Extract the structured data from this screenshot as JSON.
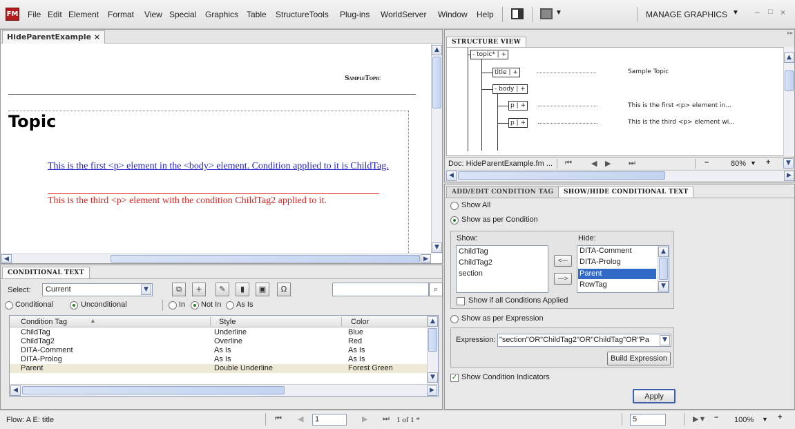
{
  "menubar": {
    "logo": "FM",
    "items": [
      "File",
      "Edit",
      "Element",
      "Format",
      "View",
      "Special",
      "Graphics",
      "Table",
      "StructureTools",
      "Plug-ins",
      "WorldServer",
      "Window",
      "Help"
    ],
    "workspace_label": "MANAGE GRAPHICS"
  },
  "document": {
    "tab_label": "HideParentExample",
    "running_header": "SampleTopic",
    "heading": "Topic",
    "paragraph1": "This is the first <p> element in the <body> element. Condition applied to it is ChildTag.",
    "paragraph2": "This is the third <p> element with the condition ChildTag2 applied to it."
  },
  "structure_view": {
    "tab_label": "STRUCTURE VIEW",
    "nodes": {
      "topic": "topic",
      "title": "title",
      "body": "body",
      "p1": "p",
      "p2": "p"
    },
    "node_texts": {
      "title": "Sample Topic",
      "p1": "This is the first <p> element in...",
      "p2": "This is the third <p> element wi..."
    },
    "doc_label": "Doc: HideParentExample.fm ...",
    "zoom": "80%"
  },
  "conditional_text": {
    "tab_label": "CONDITIONAL TEXT",
    "select_label": "Select:",
    "select_value": "Current",
    "radio_conditional": "Conditional",
    "radio_unconditional": "Unconditional",
    "radio_in": "In",
    "radio_notin": "Not In",
    "radio_asis": "As Is",
    "columns": [
      "Condition Tag",
      "Style",
      "Color"
    ],
    "rows": [
      [
        "ChildTag",
        "Underline",
        "Blue"
      ],
      [
        "ChildTag2",
        "Overline",
        "Red"
      ],
      [
        "DITA-Comment",
        "As Is",
        "As Is"
      ],
      [
        "DITA-Prolog",
        "As Is",
        "As Is"
      ],
      [
        "Parent",
        "Double Underline",
        "Forest Green"
      ]
    ]
  },
  "showhide": {
    "tab_add_edit": "ADD/EDIT CONDITION TAG",
    "tab_show_hide": "SHOW/HIDE CONDITIONAL TEXT",
    "show_all": "Show All",
    "show_per_condition": "Show as per Condition",
    "show_label": "Show:",
    "hide_label": "Hide:",
    "show_items": [
      "ChildTag",
      "ChildTag2",
      "section"
    ],
    "hide_items": [
      "DITA-Comment",
      "DITA-Prolog",
      "Parent",
      "RowTag"
    ],
    "hide_selected_index": 2,
    "move_left": "<---",
    "move_right": "--->",
    "show_if_all": "Show if all Conditions Applied",
    "show_per_expression": "Show as per Expression",
    "expression_label": "Expression:",
    "expression_value": "\"section\"OR\"ChildTag2\"OR\"ChildTag\"OR\"Pa",
    "build_expression": "Build Expression",
    "show_indicators": "Show Condition Indicators",
    "apply": "Apply"
  },
  "statusbar": {
    "flow": "Flow: A  E: title",
    "page_input": "1",
    "page_count": "1 of 1 *",
    "right_input": "5",
    "zoom": "100%"
  },
  "colors": {
    "blue_condition": "#2222cc",
    "red_condition": "#dd2222",
    "selected": "#3169c6"
  }
}
